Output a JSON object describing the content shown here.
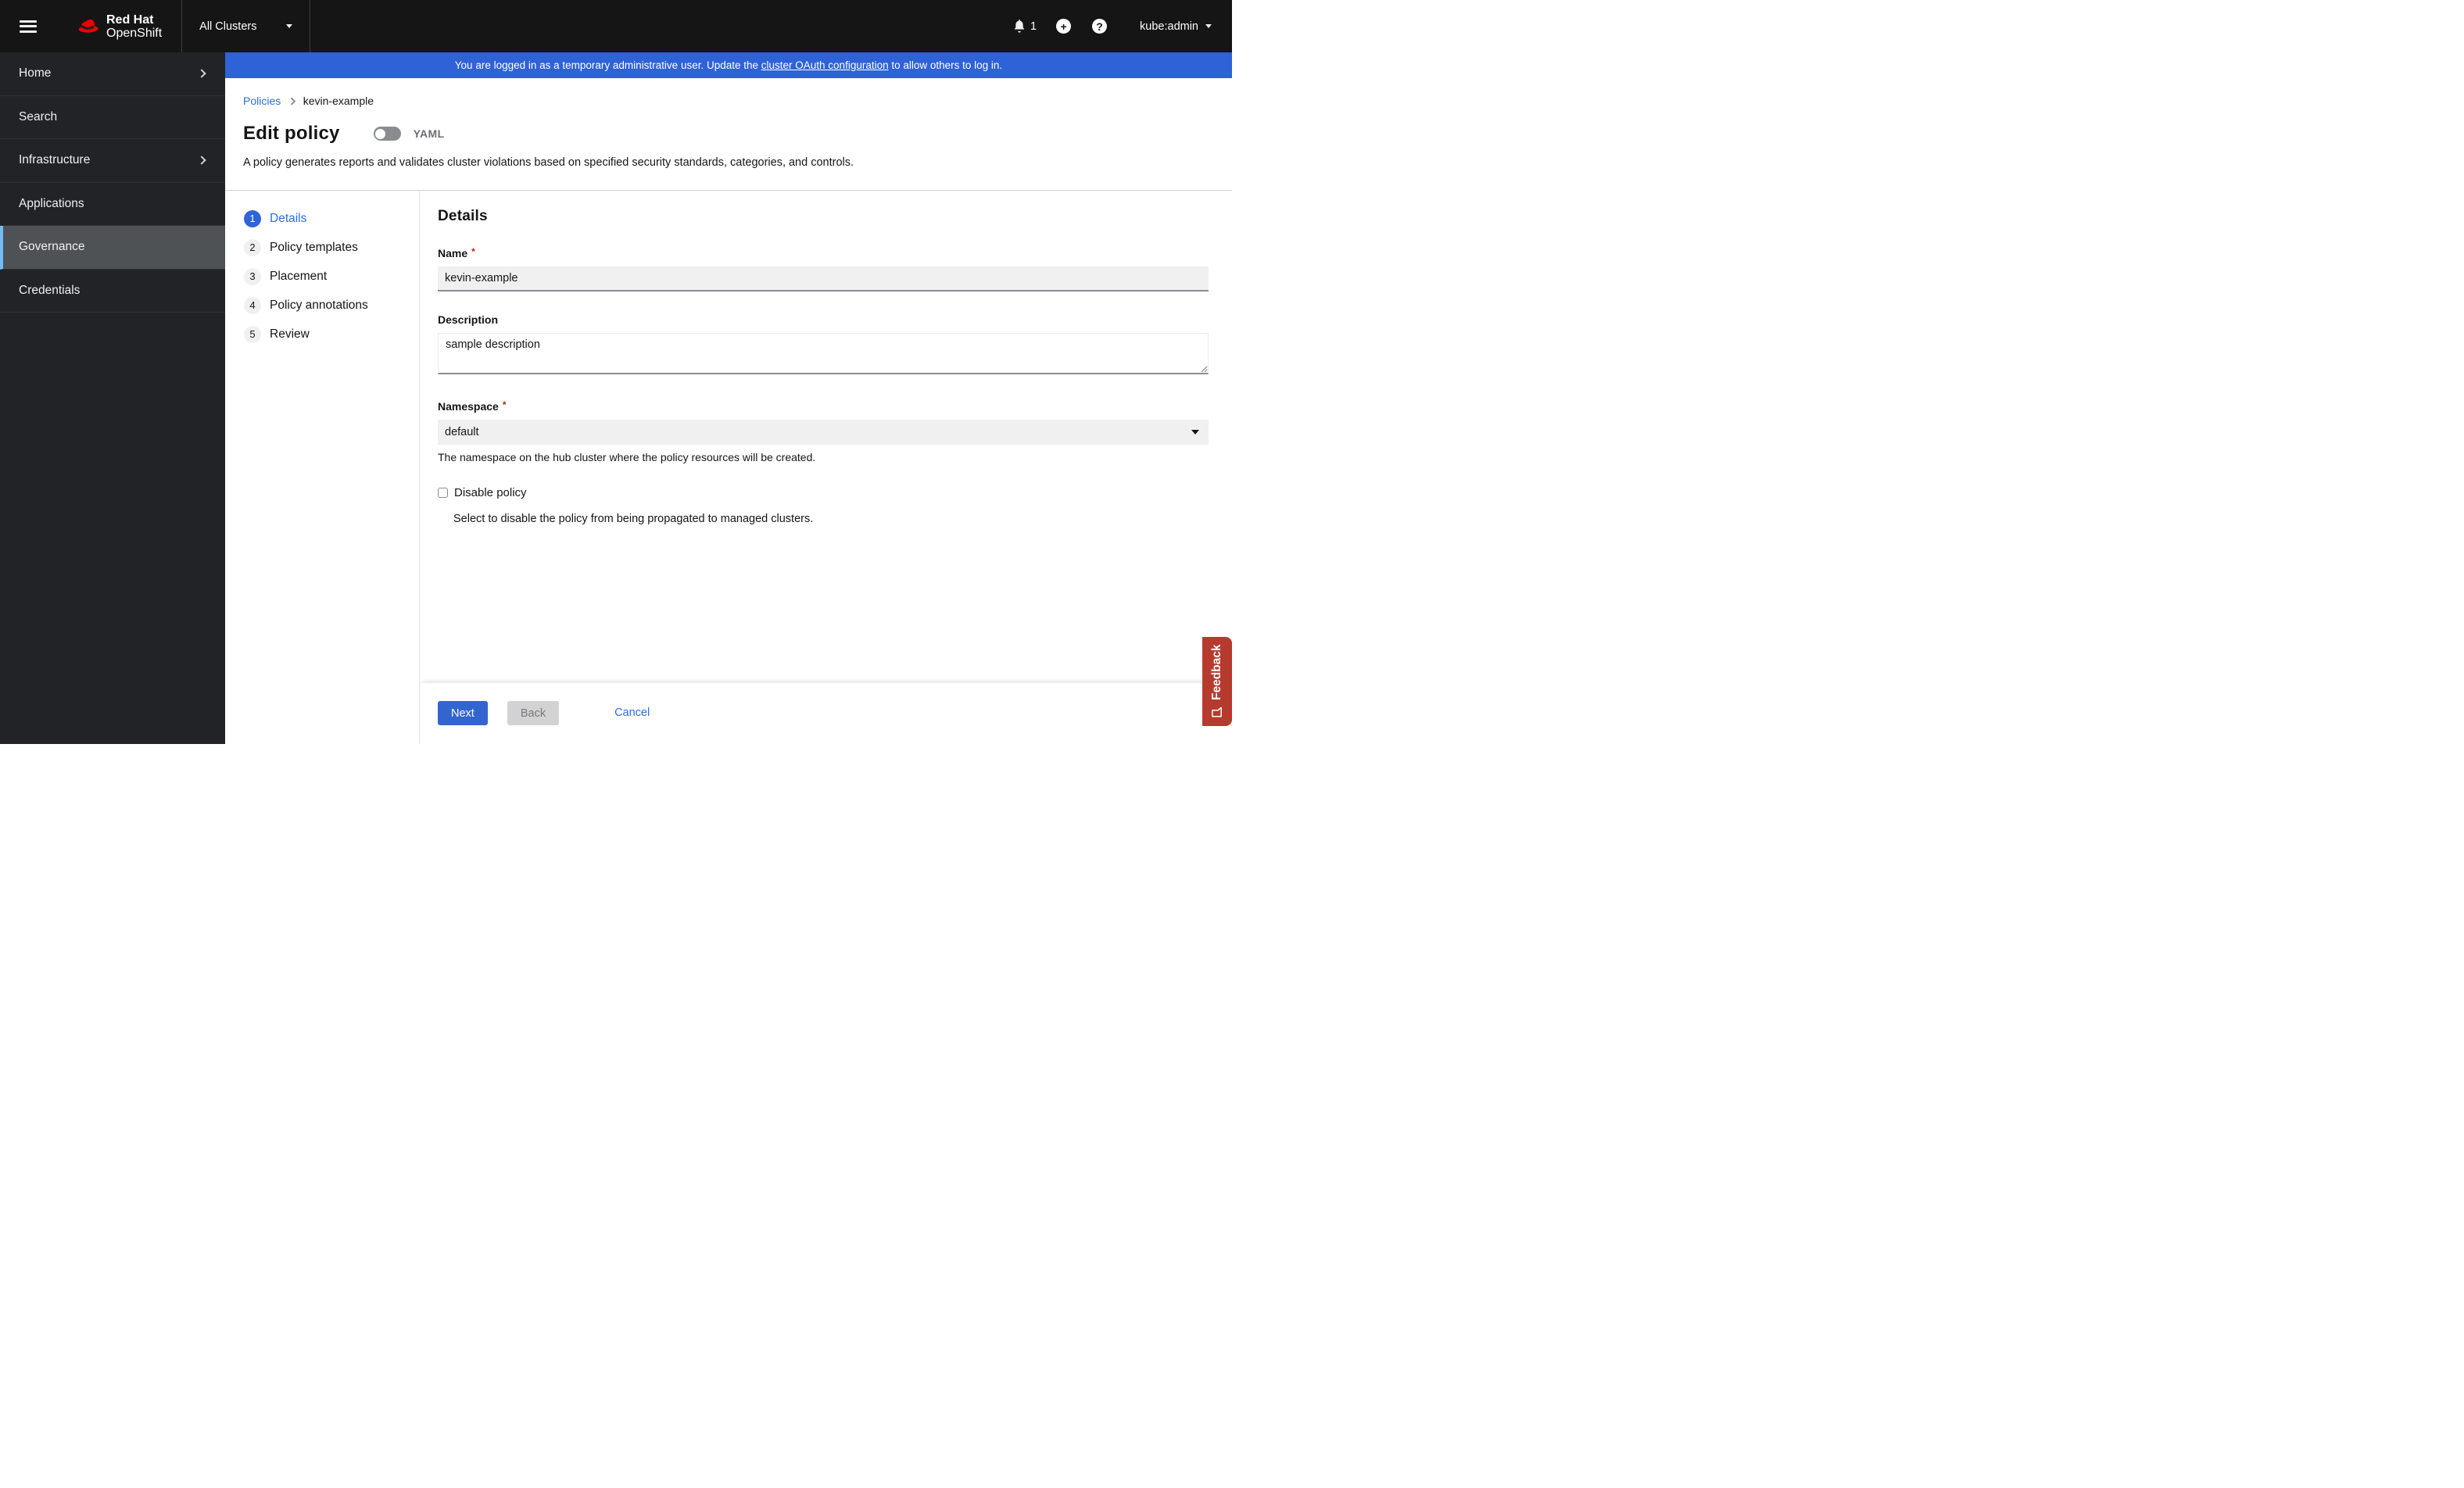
{
  "masthead": {
    "brand_line1": "Red Hat",
    "brand_line2": "OpenShift",
    "cluster_selector": "All Clusters",
    "notification_count": "1",
    "add_glyph": "+",
    "help_glyph": "?",
    "username": "kube:admin"
  },
  "banner": {
    "text_before": "You are logged in as a temporary administrative user. Update the ",
    "link": "cluster OAuth configuration",
    "text_after": " to allow others to log in."
  },
  "sidebar": {
    "items": [
      {
        "label": "Home",
        "expandable": true
      },
      {
        "label": "Search",
        "expandable": false
      },
      {
        "label": "Infrastructure",
        "expandable": true
      },
      {
        "label": "Applications",
        "expandable": false
      },
      {
        "label": "Governance",
        "expandable": false,
        "selected": true
      },
      {
        "label": "Credentials",
        "expandable": false
      }
    ]
  },
  "breadcrumb": {
    "parent": "Policies",
    "current": "kevin-example"
  },
  "header": {
    "title": "Edit policy",
    "yaml_label": "YAML",
    "description": "A policy generates reports and validates cluster violations based on specified security standards, categories, and controls."
  },
  "wizard": {
    "steps": [
      {
        "number": "1",
        "label": "Details",
        "active": true
      },
      {
        "number": "2",
        "label": "Policy templates",
        "active": false
      },
      {
        "number": "3",
        "label": "Placement",
        "active": false
      },
      {
        "number": "4",
        "label": "Policy annotations",
        "active": false
      },
      {
        "number": "5",
        "label": "Review",
        "active": false
      }
    ]
  },
  "form": {
    "section_title": "Details",
    "required_marker": "*",
    "name": {
      "label": "Name",
      "value": "kevin-example"
    },
    "description": {
      "label": "Description",
      "value": "sample description"
    },
    "namespace": {
      "label": "Namespace",
      "value": "default",
      "helper": "The namespace on the hub cluster where the policy resources will be created."
    },
    "disable_policy": {
      "label": "Disable policy",
      "helper": "Select to disable the policy from being propagated to managed clusters."
    }
  },
  "footer": {
    "next": "Next",
    "back": "Back",
    "cancel": "Cancel"
  },
  "feedback": {
    "label": "Feedback"
  },
  "colors": {
    "masthead_bg": "#151515",
    "sidebar_bg": "#212327",
    "sidebar_selected_bg": "#4f5255",
    "sidebar_selected_border": "#73bcf7",
    "banner_blue": "#2e62d6",
    "primary_button_blue": "#3365d0",
    "link_blue": "#2b6ddf",
    "active_step_blue": "#2e64d8",
    "required_red": "#c9190b",
    "feedback_red": "#b73a2f",
    "input_gray": "#f0f0f0",
    "input_border_gray": "#8a8d90"
  }
}
